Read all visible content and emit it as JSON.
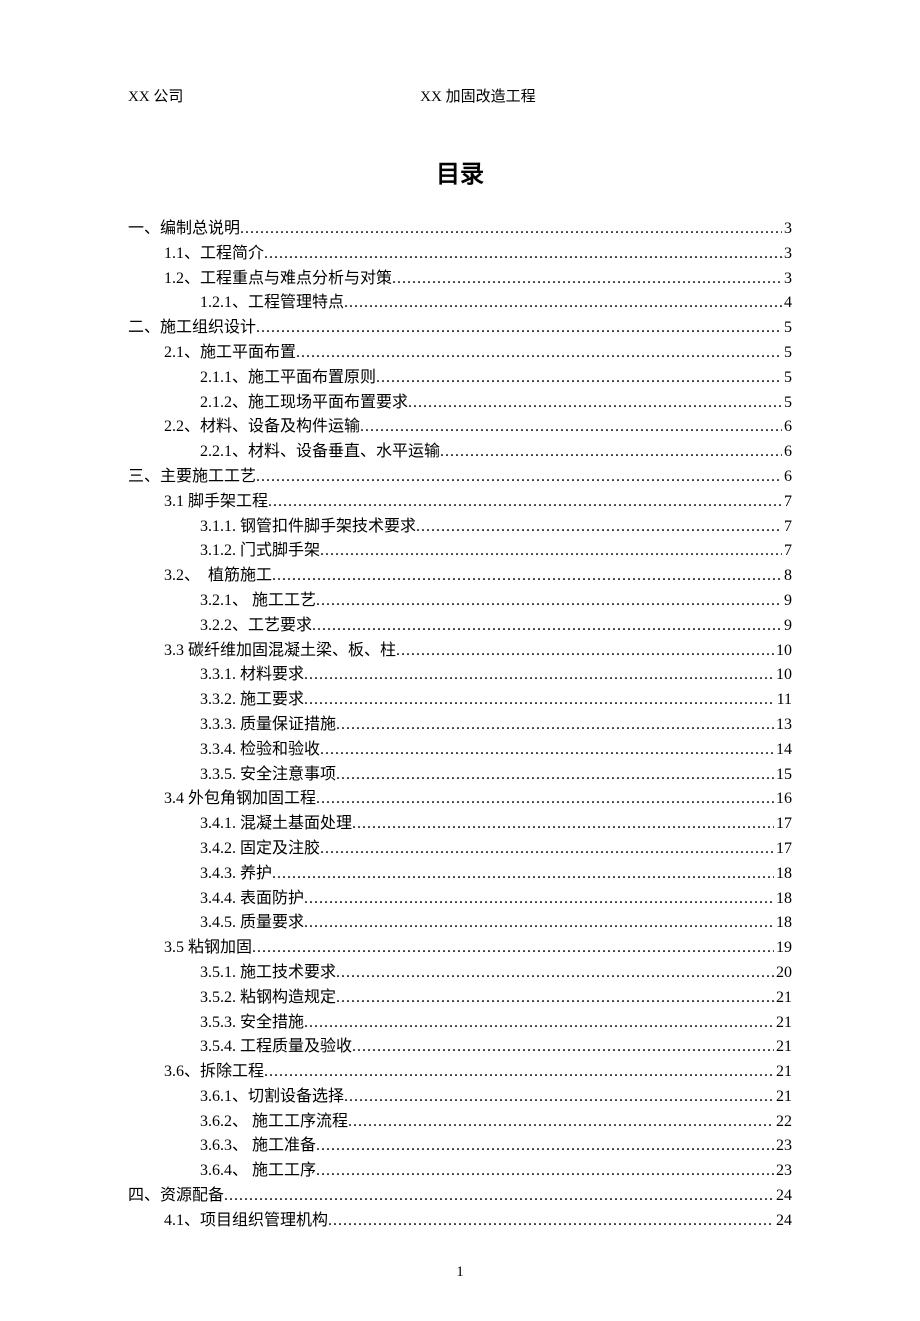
{
  "header": {
    "company": "XX 公司",
    "project": "XX 加固改造工程"
  },
  "title": "目录",
  "toc": [
    {
      "lv": 0,
      "label": "一、编制总说明",
      "page": "3"
    },
    {
      "lv": 1,
      "label": "1.1、工程简介",
      "page": "3"
    },
    {
      "lv": 1,
      "label": "1.2、工程重点与难点分析与对策",
      "page": "3"
    },
    {
      "lv": 2,
      "label": "1.2.1、工程管理特点",
      "page": "4"
    },
    {
      "lv": 0,
      "label": "二、施工组织设计",
      "page": "5"
    },
    {
      "lv": 1,
      "label": "2.1、施工平面布置",
      "page": "5"
    },
    {
      "lv": 2,
      "label": "2.1.1、施工平面布置原则",
      "page": "5"
    },
    {
      "lv": 2,
      "label": "2.1.2、施工现场平面布置要求",
      "page": "5"
    },
    {
      "lv": 1,
      "label": "2.2、材料、设备及构件运输",
      "page": "6"
    },
    {
      "lv": 2,
      "label": "2.2.1、材料、设备垂直、水平运输",
      "page": "6"
    },
    {
      "lv": 0,
      "label": "三、主要施工工艺",
      "page": "6"
    },
    {
      "lv": 1,
      "label": "3.1 脚手架工程",
      "page": "7"
    },
    {
      "lv": 2,
      "label": "3.1.1. 钢管扣件脚手架技术要求",
      "page": "7"
    },
    {
      "lv": 2,
      "label": "3.1.2. 门式脚手架",
      "page": "7"
    },
    {
      "lv": 1,
      "label": "3.2、　植筋施工",
      "page": "8"
    },
    {
      "lv": 2,
      "label": "3.2.1、 施工工艺",
      "page": "9"
    },
    {
      "lv": 2,
      "label": "3.2.2、工艺要求",
      "page": "9"
    },
    {
      "lv": 1,
      "label": "3.3 碳纤维加固混凝土梁、板、柱",
      "page": "10"
    },
    {
      "lv": 2,
      "label": "3.3.1. 材料要求",
      "page": "10"
    },
    {
      "lv": 2,
      "label": "3.3.2. 施工要求",
      "page": "11"
    },
    {
      "lv": 2,
      "label": "3.3.3. 质量保证措施",
      "page": "13"
    },
    {
      "lv": 2,
      "label": "3.3.4. 检验和验收",
      "page": "14"
    },
    {
      "lv": 2,
      "label": "3.3.5. 安全注意事项",
      "page": "15"
    },
    {
      "lv": 1,
      "label": "3.4 外包角钢加固工程",
      "page": "16"
    },
    {
      "lv": 2,
      "label": "3.4.1. 混凝土基面处理",
      "page": "17"
    },
    {
      "lv": 2,
      "label": "3.4.2. 固定及注胶",
      "page": "17"
    },
    {
      "lv": 2,
      "label": "3.4.3. 养护",
      "page": "18"
    },
    {
      "lv": 2,
      "label": "3.4.4. 表面防护",
      "page": "18"
    },
    {
      "lv": 2,
      "label": "3.4.5. 质量要求",
      "page": "18"
    },
    {
      "lv": 1,
      "label": "3.5 粘钢加固",
      "page": "19"
    },
    {
      "lv": 2,
      "label": "3.5.1. 施工技术要求",
      "page": "20"
    },
    {
      "lv": 2,
      "label": "3.5.2. 粘钢构造规定",
      "page": "21"
    },
    {
      "lv": 2,
      "label": "3.5.3. 安全措施",
      "page": "21"
    },
    {
      "lv": 2,
      "label": "3.5.4. 工程质量及验收",
      "page": "21"
    },
    {
      "lv": 1,
      "label": "3.6、拆除工程",
      "page": "21"
    },
    {
      "lv": 2,
      "label": "3.6.1、切割设备选择",
      "page": "21"
    },
    {
      "lv": 2,
      "label": "3.6.2、 施工工序流程",
      "page": "22"
    },
    {
      "lv": 2,
      "label": "3.6.3、 施工准备",
      "page": "23"
    },
    {
      "lv": 2,
      "label": "3.6.4、 施工工序",
      "page": "23"
    },
    {
      "lv": 0,
      "label": "四、资源配备",
      "page": "24"
    },
    {
      "lv": 1,
      "label": "4.1、项目组织管理机构",
      "page": "24"
    }
  ],
  "footer_page": "1"
}
